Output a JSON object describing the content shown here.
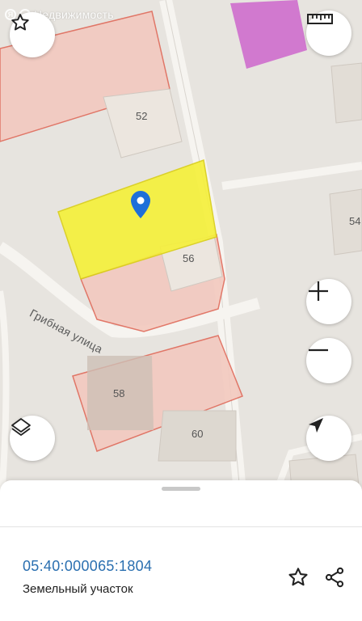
{
  "brand": {
    "logo_letter": "Я",
    "logo_text": "Недвижимость"
  },
  "map": {
    "parcels": {
      "p52": "52",
      "p54": "54",
      "p56": "56",
      "p58": "58",
      "p60": "60"
    },
    "street": "Грибная улица",
    "colors": {
      "background": "#e7e4df",
      "selected_fill": "#f5f03c",
      "parcel_fill": "#f3c9bf",
      "parcel_stroke": "#e06b5b",
      "marker": "#1e6fd9",
      "purple": "#cc66cc"
    }
  },
  "controls": {
    "favorite_icon": "star-icon",
    "ruler_icon": "ruler-icon",
    "zoom_in_icon": "plus-icon",
    "zoom_out_icon": "minus-icon",
    "layers_icon": "layers-icon",
    "locate_icon": "navigation-arrow-icon"
  },
  "sheet": {
    "cadastral_number": "05:40:000065:1804",
    "object_type": "Земельный участок",
    "favorite_icon": "star-outline-icon",
    "share_icon": "share-icon"
  }
}
